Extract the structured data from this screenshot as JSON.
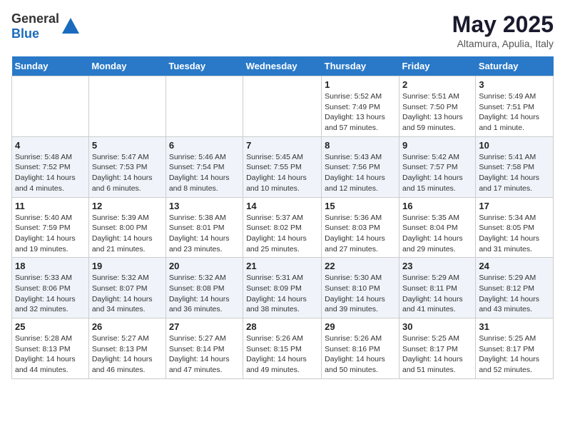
{
  "header": {
    "logo_general": "General",
    "logo_blue": "Blue",
    "title": "May 2025",
    "subtitle": "Altamura, Apulia, Italy"
  },
  "weekdays": [
    "Sunday",
    "Monday",
    "Tuesday",
    "Wednesday",
    "Thursday",
    "Friday",
    "Saturday"
  ],
  "weeks": [
    [
      {
        "day": "",
        "info": ""
      },
      {
        "day": "",
        "info": ""
      },
      {
        "day": "",
        "info": ""
      },
      {
        "day": "",
        "info": ""
      },
      {
        "day": "1",
        "info": "Sunrise: 5:52 AM\nSunset: 7:49 PM\nDaylight: 13 hours\nand 57 minutes."
      },
      {
        "day": "2",
        "info": "Sunrise: 5:51 AM\nSunset: 7:50 PM\nDaylight: 13 hours\nand 59 minutes."
      },
      {
        "day": "3",
        "info": "Sunrise: 5:49 AM\nSunset: 7:51 PM\nDaylight: 14 hours\nand 1 minute."
      }
    ],
    [
      {
        "day": "4",
        "info": "Sunrise: 5:48 AM\nSunset: 7:52 PM\nDaylight: 14 hours\nand 4 minutes."
      },
      {
        "day": "5",
        "info": "Sunrise: 5:47 AM\nSunset: 7:53 PM\nDaylight: 14 hours\nand 6 minutes."
      },
      {
        "day": "6",
        "info": "Sunrise: 5:46 AM\nSunset: 7:54 PM\nDaylight: 14 hours\nand 8 minutes."
      },
      {
        "day": "7",
        "info": "Sunrise: 5:45 AM\nSunset: 7:55 PM\nDaylight: 14 hours\nand 10 minutes."
      },
      {
        "day": "8",
        "info": "Sunrise: 5:43 AM\nSunset: 7:56 PM\nDaylight: 14 hours\nand 12 minutes."
      },
      {
        "day": "9",
        "info": "Sunrise: 5:42 AM\nSunset: 7:57 PM\nDaylight: 14 hours\nand 15 minutes."
      },
      {
        "day": "10",
        "info": "Sunrise: 5:41 AM\nSunset: 7:58 PM\nDaylight: 14 hours\nand 17 minutes."
      }
    ],
    [
      {
        "day": "11",
        "info": "Sunrise: 5:40 AM\nSunset: 7:59 PM\nDaylight: 14 hours\nand 19 minutes."
      },
      {
        "day": "12",
        "info": "Sunrise: 5:39 AM\nSunset: 8:00 PM\nDaylight: 14 hours\nand 21 minutes."
      },
      {
        "day": "13",
        "info": "Sunrise: 5:38 AM\nSunset: 8:01 PM\nDaylight: 14 hours\nand 23 minutes."
      },
      {
        "day": "14",
        "info": "Sunrise: 5:37 AM\nSunset: 8:02 PM\nDaylight: 14 hours\nand 25 minutes."
      },
      {
        "day": "15",
        "info": "Sunrise: 5:36 AM\nSunset: 8:03 PM\nDaylight: 14 hours\nand 27 minutes."
      },
      {
        "day": "16",
        "info": "Sunrise: 5:35 AM\nSunset: 8:04 PM\nDaylight: 14 hours\nand 29 minutes."
      },
      {
        "day": "17",
        "info": "Sunrise: 5:34 AM\nSunset: 8:05 PM\nDaylight: 14 hours\nand 31 minutes."
      }
    ],
    [
      {
        "day": "18",
        "info": "Sunrise: 5:33 AM\nSunset: 8:06 PM\nDaylight: 14 hours\nand 32 minutes."
      },
      {
        "day": "19",
        "info": "Sunrise: 5:32 AM\nSunset: 8:07 PM\nDaylight: 14 hours\nand 34 minutes."
      },
      {
        "day": "20",
        "info": "Sunrise: 5:32 AM\nSunset: 8:08 PM\nDaylight: 14 hours\nand 36 minutes."
      },
      {
        "day": "21",
        "info": "Sunrise: 5:31 AM\nSunset: 8:09 PM\nDaylight: 14 hours\nand 38 minutes."
      },
      {
        "day": "22",
        "info": "Sunrise: 5:30 AM\nSunset: 8:10 PM\nDaylight: 14 hours\nand 39 minutes."
      },
      {
        "day": "23",
        "info": "Sunrise: 5:29 AM\nSunset: 8:11 PM\nDaylight: 14 hours\nand 41 minutes."
      },
      {
        "day": "24",
        "info": "Sunrise: 5:29 AM\nSunset: 8:12 PM\nDaylight: 14 hours\nand 43 minutes."
      }
    ],
    [
      {
        "day": "25",
        "info": "Sunrise: 5:28 AM\nSunset: 8:13 PM\nDaylight: 14 hours\nand 44 minutes."
      },
      {
        "day": "26",
        "info": "Sunrise: 5:27 AM\nSunset: 8:13 PM\nDaylight: 14 hours\nand 46 minutes."
      },
      {
        "day": "27",
        "info": "Sunrise: 5:27 AM\nSunset: 8:14 PM\nDaylight: 14 hours\nand 47 minutes."
      },
      {
        "day": "28",
        "info": "Sunrise: 5:26 AM\nSunset: 8:15 PM\nDaylight: 14 hours\nand 49 minutes."
      },
      {
        "day": "29",
        "info": "Sunrise: 5:26 AM\nSunset: 8:16 PM\nDaylight: 14 hours\nand 50 minutes."
      },
      {
        "day": "30",
        "info": "Sunrise: 5:25 AM\nSunset: 8:17 PM\nDaylight: 14 hours\nand 51 minutes."
      },
      {
        "day": "31",
        "info": "Sunrise: 5:25 AM\nSunset: 8:17 PM\nDaylight: 14 hours\nand 52 minutes."
      }
    ]
  ]
}
